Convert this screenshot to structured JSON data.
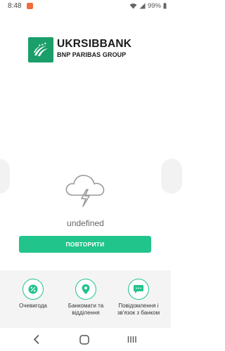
{
  "status_bar": {
    "time": "8:48",
    "battery": "99%",
    "icons": [
      "notification-icon",
      "wifi-icon",
      "signal-icon",
      "battery-icon"
    ]
  },
  "logo": {
    "name": "UKRSIBBANK",
    "subtitle": "BNP PARIBAS GROUP",
    "brand_color": "#1a9e6a"
  },
  "main": {
    "icon": "cloud-lightning-icon",
    "error_text": "undefined",
    "retry_label": "ПОВТОРИТИ",
    "accent_color": "#21c48a"
  },
  "quick_links": [
    {
      "icon": "percent-icon",
      "label": "Очевигода"
    },
    {
      "icon": "location-pin-icon",
      "label": "Банкомати та відділення"
    },
    {
      "icon": "chat-icon",
      "label": "Повідомлення і зв'язок з банком"
    }
  ],
  "nav_bar": {
    "icons": [
      "back-icon",
      "home-icon",
      "recents-icon"
    ]
  }
}
